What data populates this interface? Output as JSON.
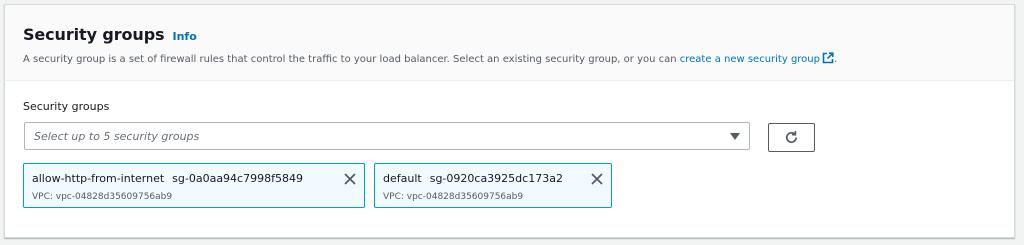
{
  "header": {
    "title": "Security groups",
    "info_label": "Info",
    "description": "A security group is a set of firewall rules that control the traffic to your load balancer. Select an existing security group, or you can ",
    "create_link": "create a new security group",
    "description_end": "."
  },
  "field": {
    "label": "Security groups",
    "placeholder": "Select up to 5 security groups"
  },
  "tokens": [
    {
      "name": "allow-http-from-internet",
      "id": "sg-0a0aa94c7998f5849",
      "vpc": "VPC: vpc-04828d35609756ab9"
    },
    {
      "name": "default",
      "id": "sg-0920ca3925dc173a2",
      "vpc": "VPC: vpc-04828d35609756ab9"
    }
  ],
  "icons": {
    "external": "external-link-icon",
    "caret": "caret-down-icon",
    "refresh": "refresh-icon",
    "close": "close-icon"
  },
  "colors": {
    "link": "#0073bb",
    "token_border": "#00a1c9",
    "token_bg": "#f1faff"
  }
}
